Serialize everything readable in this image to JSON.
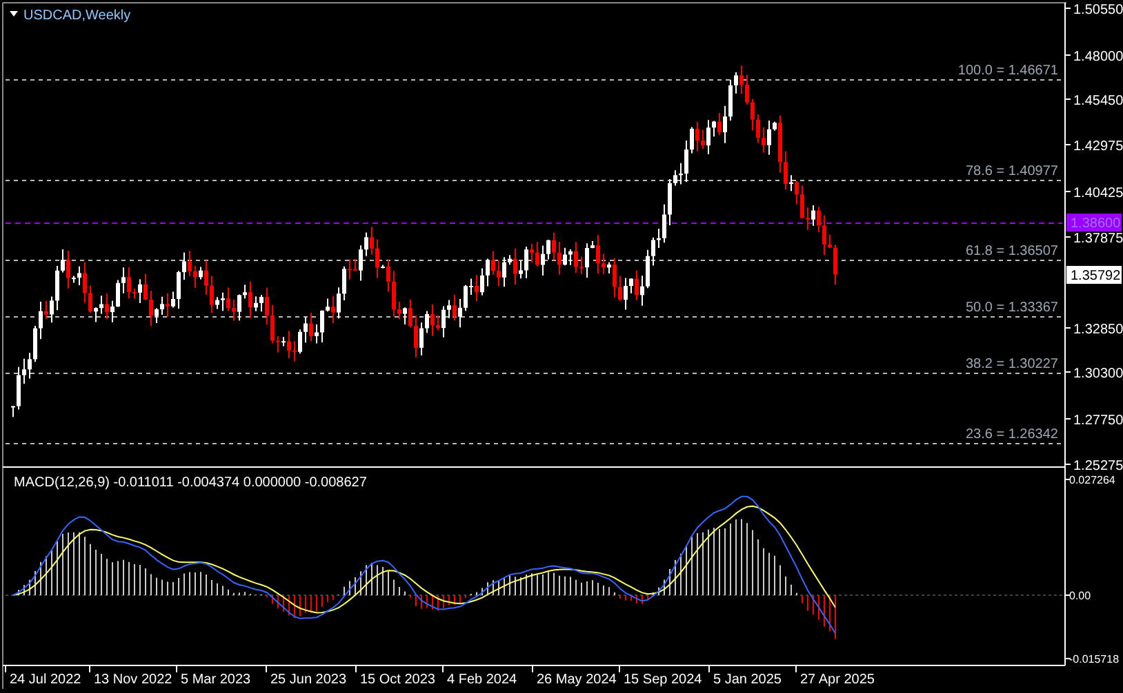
{
  "chart": {
    "title": "USDCAD,Weekly"
  },
  "price_axis": [
    "1.50550",
    "1.48000",
    "1.45450",
    "1.42975",
    "1.40425",
    "1.37875",
    "1.32850",
    "1.30300",
    "1.27750",
    "1.25275"
  ],
  "fib_levels": [
    "100.0 = 1.46671",
    "78.6 = 1.40977",
    "61.8 = 1.36507",
    "50.0 = 1.33367",
    "38.2 = 1.30227",
    "23.6 = 1.26342"
  ],
  "horizontal_line": {
    "label": "1.38600",
    "color": "#9900ff"
  },
  "current_price": "1.35792",
  "macd": {
    "label": "MACD(12,26,9) -0.011011 -0.004374 0.000000 -0.008627",
    "axis": [
      "0.027264",
      "0.00",
      "-0.015718"
    ]
  },
  "time_axis": [
    "24 Jul 2022",
    "13 Nov 2022",
    "5 Mar 2023",
    "25 Jun 2023",
    "15 Oct 2023",
    "4 Feb 2024",
    "26 May 2024",
    "15 Sep 2024",
    "5 Jan 2025",
    "27 Apr 2025"
  ]
}
